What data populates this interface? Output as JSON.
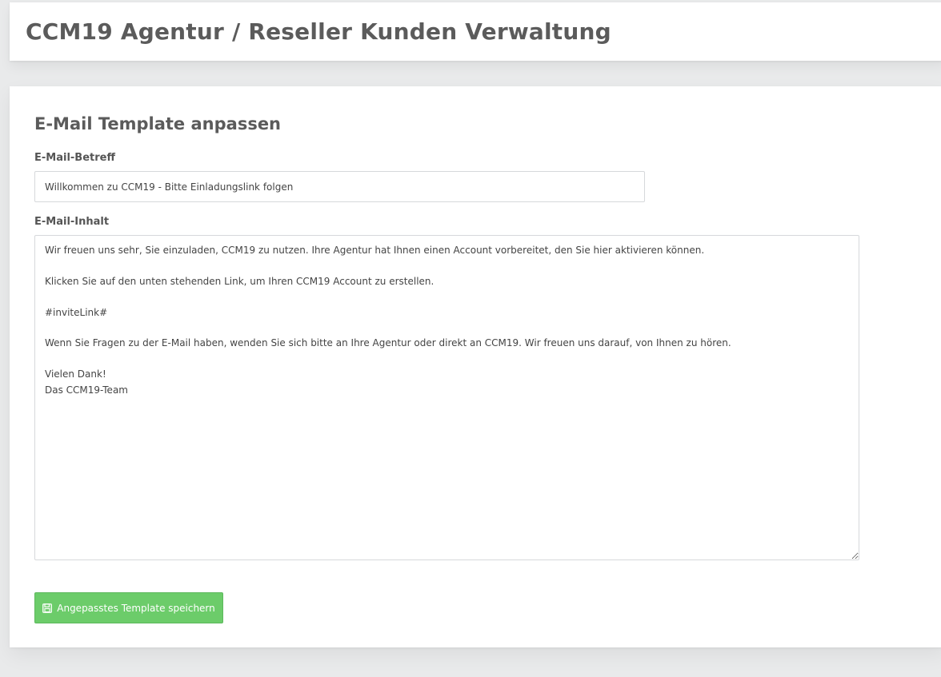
{
  "header": {
    "title": "CCM19 Agentur / Reseller Kunden Verwaltung"
  },
  "template_card": {
    "title": "E-Mail Template anpassen",
    "subject": {
      "label": "E-Mail-Betreff",
      "value": "Willkommen zu CCM19 - Bitte Einladungslink folgen"
    },
    "content": {
      "label": "E-Mail-Inhalt",
      "value": "Wir freuen uns sehr, Sie einzuladen, CCM19 zu nutzen. Ihre Agentur hat Ihnen einen Account vorbereitet, den Sie hier aktivieren können.\n\nKlicken Sie auf den unten stehenden Link, um Ihren CCM19 Account zu erstellen.\n\n#inviteLink#\n\nWenn Sie Fragen zu der E-Mail haben, wenden Sie sich bitte an Ihre Agentur oder direkt an CCM19. Wir freuen uns darauf, von Ihnen zu hören.\n\nVielen Dank!\nDas CCM19-Team"
    },
    "save_button": {
      "icon": "save-icon",
      "label": "Angepasstes Template speichern",
      "color": "#6ccc6a"
    }
  }
}
